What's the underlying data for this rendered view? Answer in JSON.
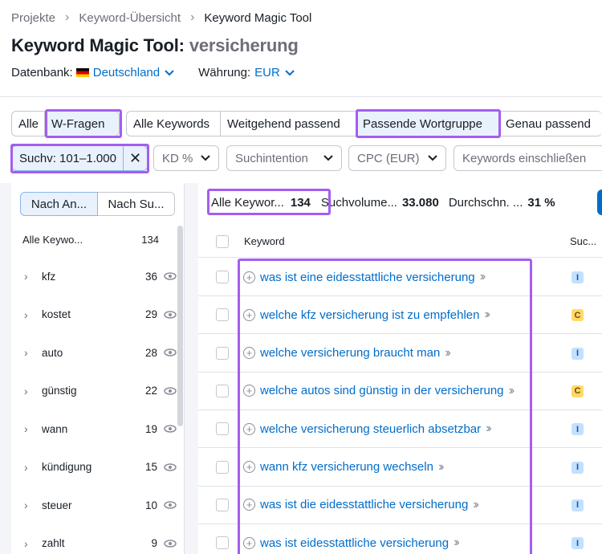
{
  "breadcrumb": {
    "items": [
      "Projekte",
      "Keyword-Übersicht",
      "Keyword Magic Tool"
    ]
  },
  "header": {
    "title": "Keyword Magic Tool:",
    "query": "versicherung"
  },
  "settings": {
    "database_label": "Datenbank:",
    "database_value": "Deutschland",
    "currency_label": "Währung:",
    "currency_value": "EUR"
  },
  "question_tabs": {
    "all": "Alle",
    "questions": "W-Fragen"
  },
  "match_tabs": [
    "Alle Keywords",
    "Weitgehend passend",
    "Passende Wortgruppe",
    "Genau passend"
  ],
  "filters": {
    "volume": "Suchv: 101–1.000",
    "kd": "KD %",
    "intent": "Suchintention",
    "cpc": "CPC (EUR)",
    "include_placeholder": "Keywords einschließen"
  },
  "sidebar": {
    "sort_by_number": "Nach An...",
    "sort_by_volume": "Nach Su...",
    "all_label": "Alle Keywo...",
    "all_count": "134",
    "groups": [
      {
        "name": "kfz",
        "count": "36"
      },
      {
        "name": "kostet",
        "count": "29"
      },
      {
        "name": "auto",
        "count": "28"
      },
      {
        "name": "günstig",
        "count": "22"
      },
      {
        "name": "wann",
        "count": "19"
      },
      {
        "name": "kündigung",
        "count": "15"
      },
      {
        "name": "steuer",
        "count": "10"
      },
      {
        "name": "zahlt",
        "count": "9"
      }
    ]
  },
  "stats": {
    "all_label": "Alle Keywor...",
    "all_value": "134",
    "volume_label": "Suchvolume...",
    "volume_value": "33.080",
    "avg_label": "Durchschn. ...",
    "avg_value": "31 %"
  },
  "table": {
    "col_keyword": "Keyword",
    "col_intent": "Suc...",
    "rows": [
      {
        "keyword": "was ist eine eidesstattliche versicherung",
        "intent": "I"
      },
      {
        "keyword": "welche kfz versicherung ist zu empfehlen",
        "intent": "C"
      },
      {
        "keyword": "welche versicherung braucht man",
        "intent": "I"
      },
      {
        "keyword": "welche autos sind günstig in der versicherung",
        "intent": "C"
      },
      {
        "keyword": "welche versicherung steuerlich absetzbar",
        "intent": "I"
      },
      {
        "keyword": "wann kfz versicherung wechseln",
        "intent": "I"
      },
      {
        "keyword": "was ist die eidesstattliche versicherung",
        "intent": "I"
      },
      {
        "keyword": "was ist eidesstattliche versicherung",
        "intent": "I"
      }
    ]
  },
  "colors": {
    "link": "#006dca",
    "highlight": "#a45df0",
    "active_bg": "#e9f1fd"
  }
}
